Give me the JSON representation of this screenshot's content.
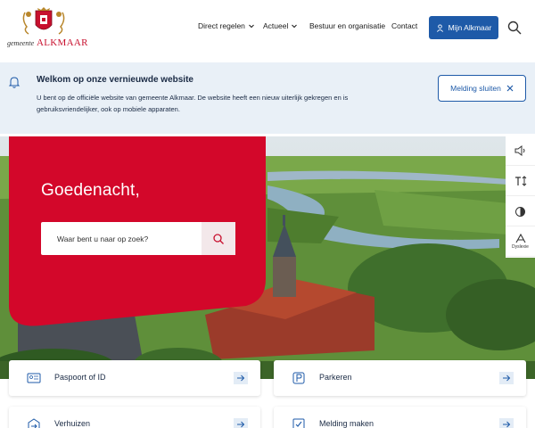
{
  "header": {
    "logo": {
      "small": "gemeente",
      "big": "ALKMAAR",
      "icon": "coat-of-arms-icon"
    },
    "nav": [
      {
        "label": "Direct regelen",
        "has_dropdown": true
      },
      {
        "label": "Actueel",
        "has_dropdown": true
      },
      {
        "label": "Bestuur en organisatie",
        "has_dropdown": false
      },
      {
        "label": "Contact",
        "has_dropdown": false
      }
    ],
    "account_button": "Mijn Alkmaar",
    "search_icon": "search-icon"
  },
  "banner": {
    "title": "Welkom op onze vernieuwde website",
    "text": "U bent op de officiële website van gemeente Alkmaar. De website heeft een nieuw uiterlijk gekregen en is gebruiksvriendelijker, ook op mobiele apparaten.",
    "close_label": "Melding sluiten"
  },
  "hero": {
    "greeting": "Goedenacht,",
    "search_placeholder": "Waar bent u naar op zoek?"
  },
  "toolbar": {
    "tools": [
      {
        "icon": "speaker-icon",
        "label": ""
      },
      {
        "icon": "text-size-icon",
        "label": ""
      },
      {
        "icon": "contrast-icon",
        "label": ""
      },
      {
        "icon": "dyslexia-icon",
        "label": "Dyslexie"
      }
    ]
  },
  "cards": [
    {
      "label": "Paspoort of ID",
      "icon": "id-card-icon"
    },
    {
      "label": "Parkeren",
      "icon": "parking-icon"
    },
    {
      "label": "Verhuizen",
      "icon": "moving-icon"
    },
    {
      "label": "Melding maken",
      "icon": "report-icon"
    }
  ],
  "colors": {
    "brand_red": "#c8102e",
    "brand_blue": "#1e5aa8",
    "banner_bg": "#e9f0f7"
  }
}
